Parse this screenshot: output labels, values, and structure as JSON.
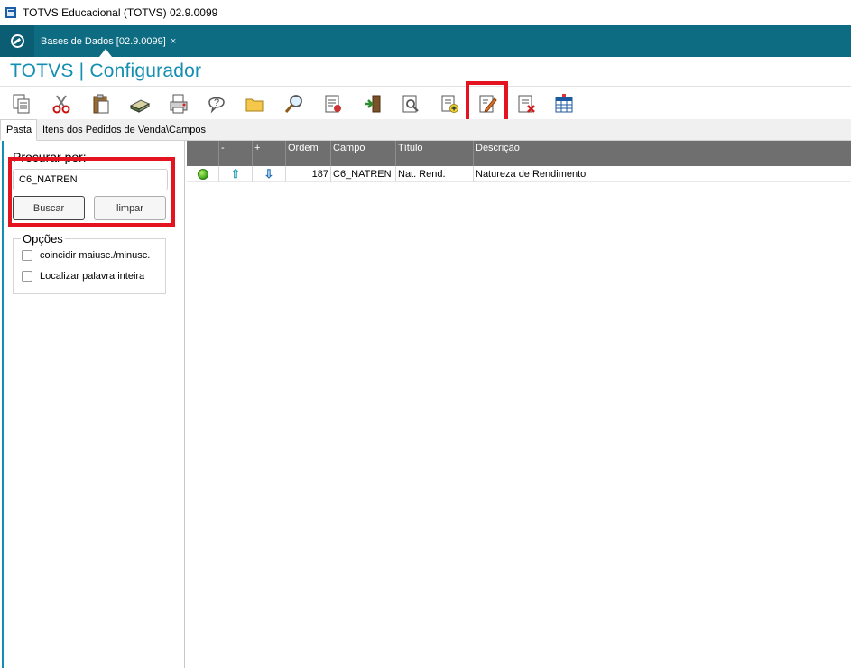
{
  "window": {
    "title": "TOTVS Educacional (TOTVS) 02.9.0099"
  },
  "tabbar": {
    "tab_label": "Bases de Dados [02.9.0099]",
    "close_glyph": "×"
  },
  "header": {
    "title": "TOTVS | Configurador"
  },
  "toolbar": {
    "icons": [
      "copy-icon",
      "cut-icon",
      "paste-icon",
      "book-icon",
      "print-icon",
      "help-icon",
      "folder-icon",
      "search-icon",
      "document-icon",
      "exit-icon",
      "preview-icon",
      "add-document-icon",
      "edit-icon",
      "delete-document-icon",
      "table-icon"
    ],
    "highlighted": "edit-icon"
  },
  "tabs": {
    "active": "Pasta",
    "path": "Itens dos Pedidos de Venda\\Campos"
  },
  "search": {
    "label": "Procurar por:",
    "value": "C6_NATREN",
    "buscar": "Buscar",
    "limpar": "limpar"
  },
  "options": {
    "legend": "Opções",
    "items": [
      "coincidir maiusc./minusc.",
      "Localizar palavra inteira"
    ]
  },
  "grid": {
    "columns": [
      "",
      "-",
      "+",
      "Ordem",
      "Campo",
      "Título",
      "Descrição"
    ],
    "rows": [
      {
        "status": "green",
        "up": "⇧",
        "down": "⇩",
        "ordem": "187",
        "campo": "C6_NATREN",
        "titulo": "Nat. Rend.",
        "descricao": "Natureza de Rendimento"
      }
    ]
  },
  "colors": {
    "accent": "#148fb1",
    "tabbar": "#0d6b82",
    "highlight": "#e3141f",
    "grid_header": "#6f6f6f"
  }
}
